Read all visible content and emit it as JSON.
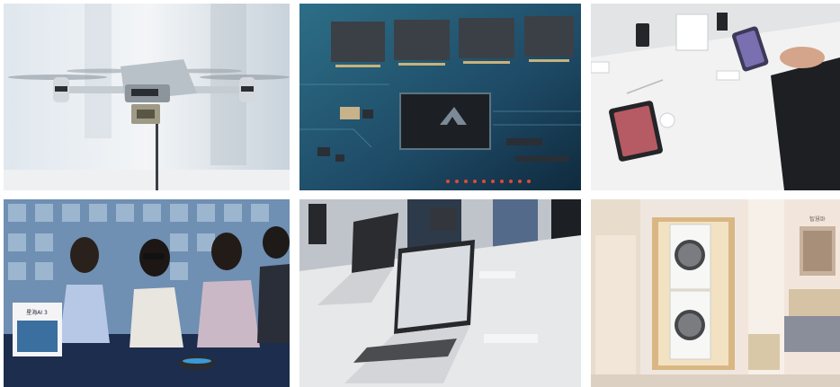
{
  "photos": [
    {
      "subject": "drone"
    },
    {
      "subject": "circuit-board"
    },
    {
      "subject": "smartphones-display"
    },
    {
      "subject": "vr-glasses-exhibit"
    },
    {
      "subject": "laptops-display"
    },
    {
      "subject": "washer-dryer-showroom"
    }
  ],
  "photo_text": {
    "poster_label": "星海AI 3",
    "sign_label": "智慧卧"
  },
  "colors": {
    "background": "#ffffff",
    "board_blue": "#1e4a66",
    "showroom_wood": "#d9b784"
  }
}
